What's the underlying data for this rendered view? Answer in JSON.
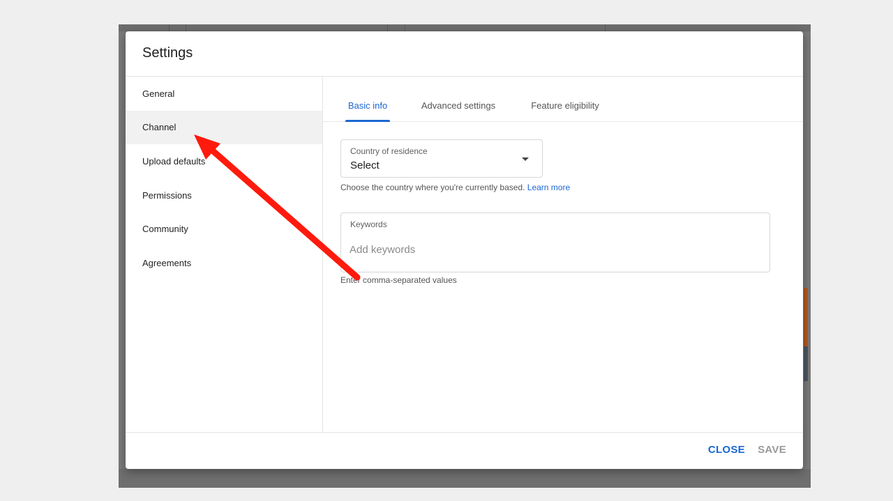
{
  "dialog": {
    "title": "Settings",
    "close_label": "CLOSE",
    "save_label": "SAVE"
  },
  "sidebar": {
    "items": [
      {
        "label": "General",
        "active": false
      },
      {
        "label": "Channel",
        "active": true
      },
      {
        "label": "Upload defaults",
        "active": false
      },
      {
        "label": "Permissions",
        "active": false
      },
      {
        "label": "Community",
        "active": false
      },
      {
        "label": "Agreements",
        "active": false
      }
    ]
  },
  "tabs": [
    {
      "label": "Basic info",
      "active": true
    },
    {
      "label": "Advanced settings",
      "active": false
    },
    {
      "label": "Feature eligibility",
      "active": false
    }
  ],
  "country": {
    "label": "Country of residence",
    "value": "Select",
    "help": "Choose the country where you're currently based.",
    "learn_more": "Learn more"
  },
  "keywords": {
    "label": "Keywords",
    "placeholder": "Add keywords",
    "help": "Enter comma-separated values"
  },
  "colors": {
    "accent": "#1a67d2",
    "annotation_arrow": "#ff1a0d"
  },
  "icons": {
    "dropdown": "caret-down-icon",
    "annotation": "red-arrow-icon"
  }
}
